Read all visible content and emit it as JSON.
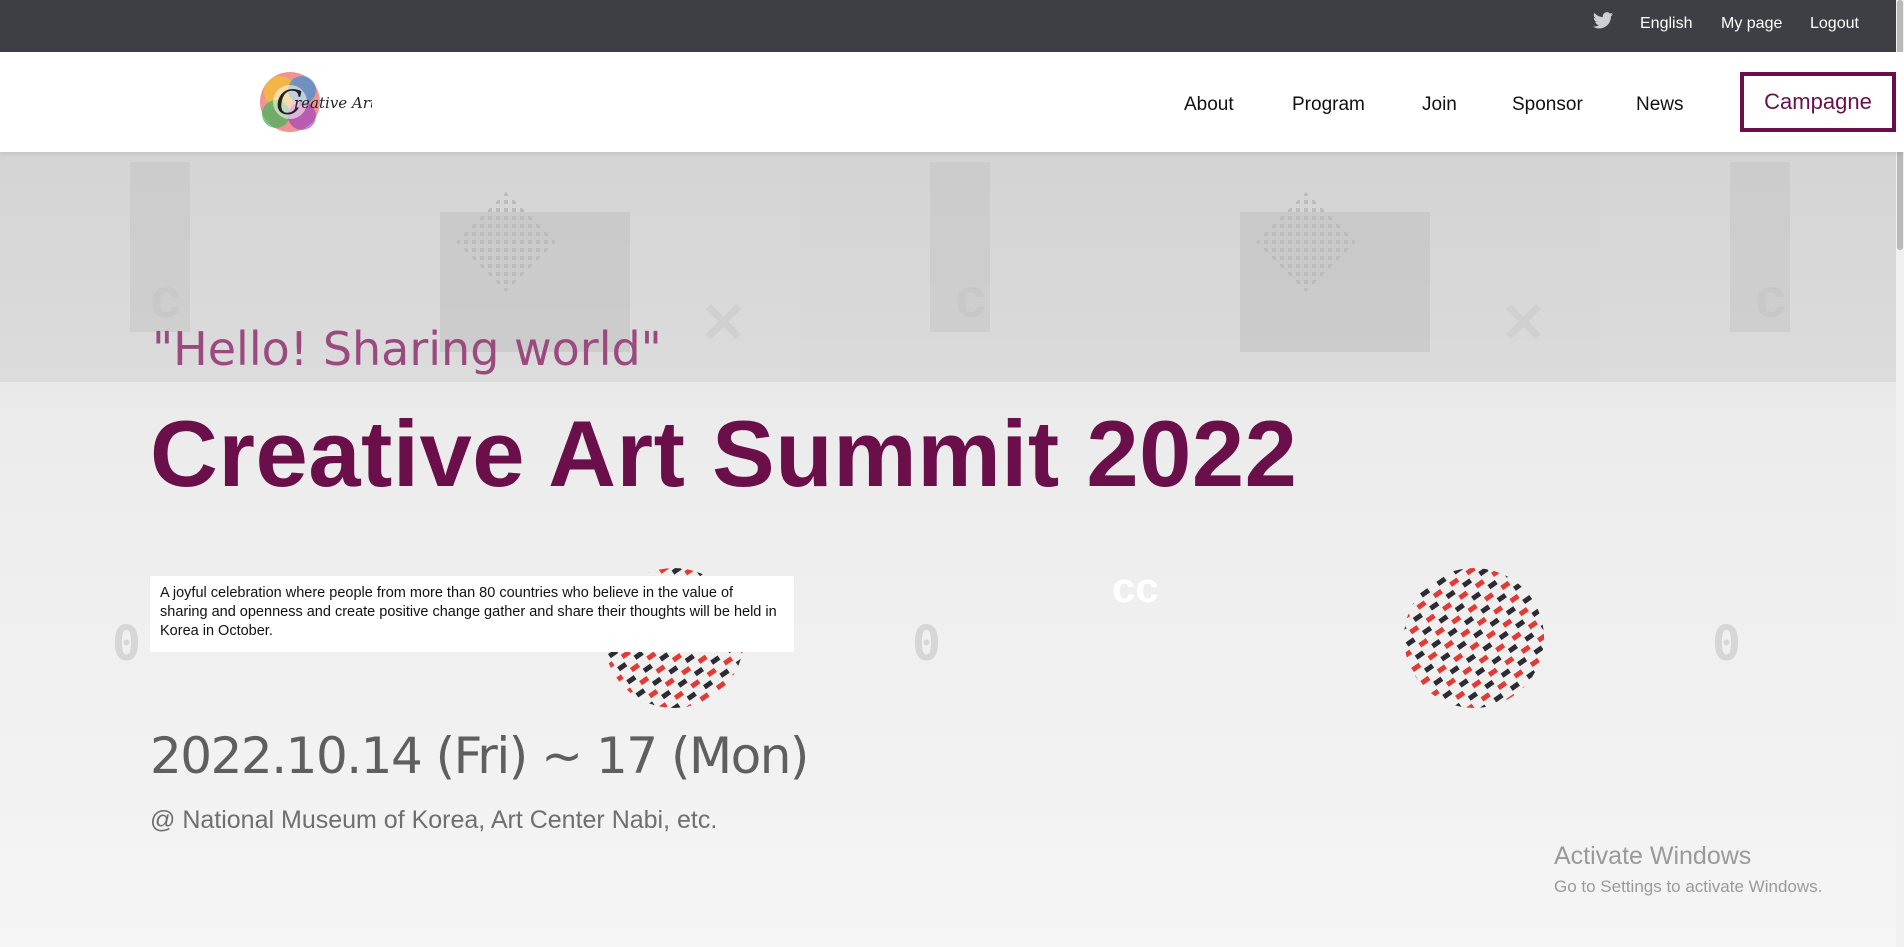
{
  "topbar": {
    "social_icon": "twitter-icon",
    "language": "English",
    "mypage": "My page",
    "logout": "Logout"
  },
  "header": {
    "logo_text": "Creative Art",
    "nav": [
      "About",
      "Program",
      "Join",
      "Sponsor",
      "News"
    ],
    "cta": "Campagne"
  },
  "hero": {
    "subtitle": "\"Hello! Sharing world\"",
    "title": "Creative Art Summit 2022",
    "description": "A joyful celebration where people from more than 80 countries who believe in the value of sharing and openness and create positive change gather and share their thoughts will be held in Korea in October.",
    "date": "2022.10.14 (Fri) ~ 17 (Mon)",
    "venue": "@ National Museum of Korea, Art Center Nabi, etc."
  },
  "watermark": {
    "line1": "Activate Windows",
    "line2": "Go to Settings to activate Windows."
  },
  "colors": {
    "topbar_bg": "#3e3f44",
    "brand_purple": "#6b0f4a",
    "subtitle_purple": "#9a4a7f"
  }
}
